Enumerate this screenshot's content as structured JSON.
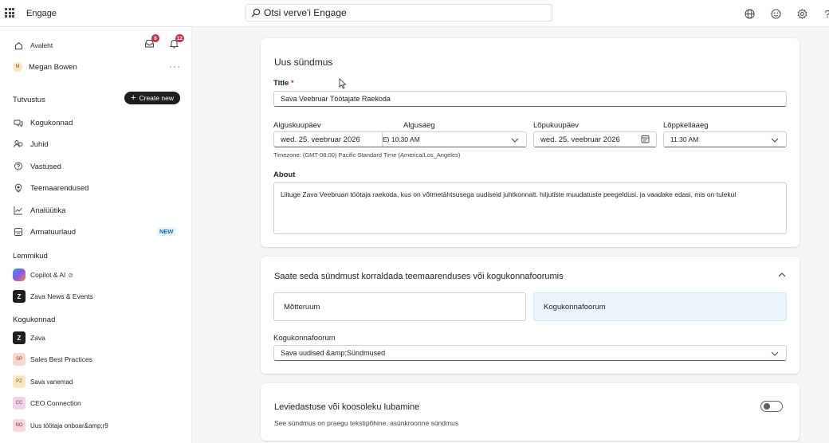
{
  "app": {
    "name": "Engage"
  },
  "search": {
    "placeholder": "Otsi verve'i Engage"
  },
  "topbar": {
    "icons": [
      "globe-icon",
      "smiley-icon",
      "gear-icon",
      "help-icon"
    ]
  },
  "sidebar": {
    "home": {
      "label": "Avaleht",
      "inbox_badge": "6",
      "bell_badge": "12"
    },
    "user": {
      "name": "Megan Bowen",
      "initial": "M"
    },
    "discover_header": "Tutvustus",
    "create_label": "Create new",
    "nav": [
      {
        "label": "Kogukonnad",
        "icon": "communities-icon"
      },
      {
        "label": "Juhid",
        "icon": "leaders-icon"
      },
      {
        "label": "Vastused",
        "icon": "answers-icon"
      },
      {
        "label": "Teemaarendused",
        "icon": "storylines-icon"
      },
      {
        "label": "Analüütika",
        "icon": "analytics-icon"
      },
      {
        "label": "Armatuurlaud",
        "icon": "dashboard-icon"
      }
    ],
    "new_badge": "NEW",
    "favorites_header": "Lemmikud",
    "favorites": [
      {
        "label": "Copilot & AI",
        "icon": "copilot-icon"
      },
      {
        "label": "Zava News & Events",
        "initials": "Z"
      }
    ],
    "communities_header": "Kogukonnad",
    "communities": [
      {
        "label": "Zava",
        "initials": "Z",
        "color": "#1f1f1f",
        "fg": "#ffffff"
      },
      {
        "label": "Sales Best Practices",
        "initials": "SP",
        "color": "#f6d9cf",
        "fg": "#8a3b1f"
      },
      {
        "label": "Sava vanemad",
        "initials": "PZ",
        "color": "#fbe7c4",
        "fg": "#7a5a12"
      },
      {
        "label": "CEO Connection",
        "initials": "CC",
        "color": "#f2d3ee",
        "fg": "#7a2a70"
      },
      {
        "label": "Uus töötaja onboar&amp;r9",
        "initials": "NO",
        "color": "#f6d9dc",
        "fg": "#8a2530"
      }
    ]
  },
  "form": {
    "heading": "Uus sündmus",
    "title_label": "Title",
    "title_required_mark": "*",
    "title_value": "Sava Veebruar Töötajate Raekoda",
    "start_date_label": "Alguskuupäev",
    "start_date_value": "wed. 25. veebruar 2026",
    "start_time_label": "Algusaeg",
    "start_time_value": "E) 10:30 AM",
    "end_date_label": "Lõpukuupäev",
    "end_date_value": "wed. 25. veebruar 2026",
    "end_time_label": "Lõppkellaaeg",
    "end_time_value": "11:30 AM",
    "timezone_note": "Timezone: (GMT-08:00) Pacific Standard Time (America/Los_Angeles)",
    "about_label": "About",
    "about_value": "Liituge   Zava Veebruari töötaja raekoda, kus on võtmetähtsusega uudiseid juhtkonnalt. hiljutiste muudatuste peegeldusi. ja vaadake edasi, mis on tulekul"
  },
  "forum": {
    "heading": "Saate seda sündmust korraldada teemaarenduses või kogukonnafoorumis",
    "option_storyline": "Mõtteruum",
    "option_community": "Kogukonnafoorum",
    "community_label": "Kogukonnafoorum",
    "community_value": "Sava uudised &amp;Sündmused"
  },
  "livestream": {
    "heading": "Leviedastuse või koosoleku lubamine",
    "description": "See sündmus on praegu tekstipõhine. asünkroonne sündmus",
    "enabled": false
  },
  "colors": {
    "accent": "#0f6cbd",
    "selected_bg": "#ebf3fc",
    "badge": "#c4314b"
  }
}
